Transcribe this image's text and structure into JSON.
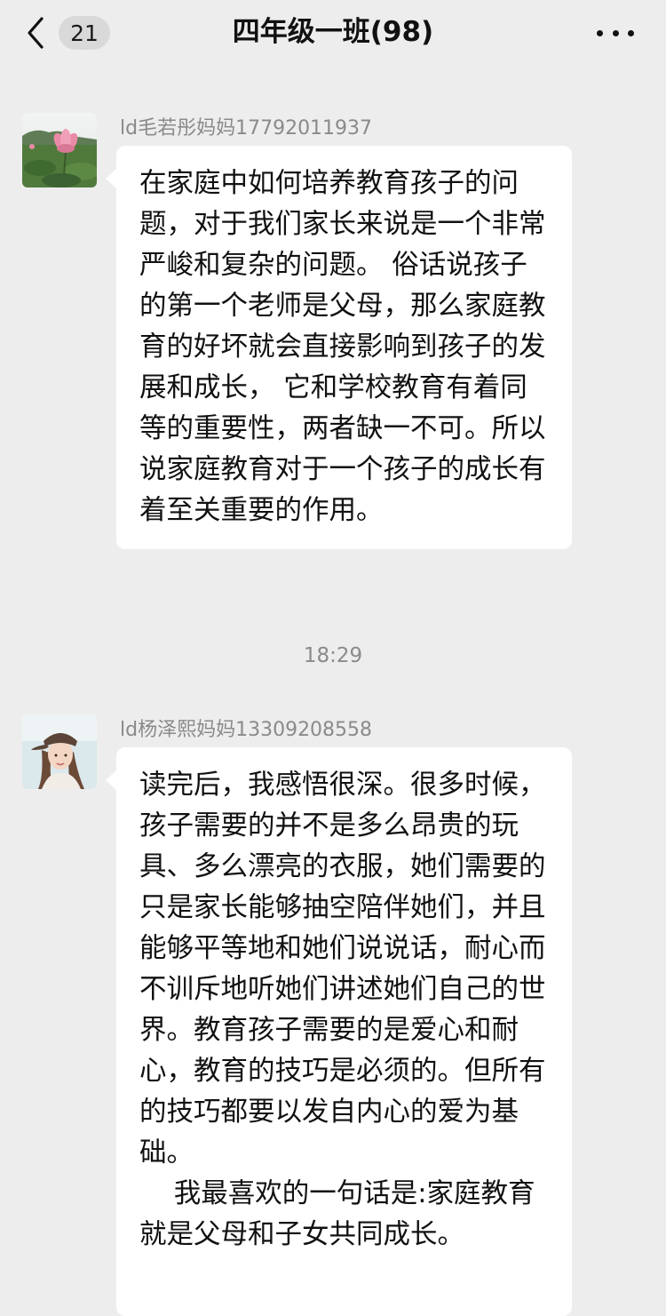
{
  "header": {
    "title": "四年级一班(98)",
    "unread_count": "21",
    "back_icon": "chevron-left-icon",
    "more_icon": "more-dots-icon"
  },
  "messages": [
    {
      "sender": "ld毛若彤妈妈17792011937",
      "avatar": "lotus-flower-avatar",
      "text": "在家庭中如何培养教育孩子的问题，对于我们家长来说是一个非常严峻和复杂的问题。 俗话说孩子的第一个老师是父母，那么家庭教育的好坏就会直接影响到孩子的发展和成长， 它和学校教育有着同等的重要性，两者缺一不可。所以说家庭教育对于一个孩子的成长有着至关重要的作用。"
    },
    {
      "sender": "ld杨泽熙妈妈13309208558",
      "avatar": "woman-with-cap-avatar",
      "text": "读完后，我感悟很深。很多时候，孩子需要的并不是多么昂贵的玩具、多么漂亮的衣服，她们需要的只是家长能够抽空陪伴她们，并且能够平等地和她们说说话，耐心而不训斥地听她们讲述她们自己的世界。教育孩子需要的是爱心和耐心，教育的技巧是必须的。但所有的技巧都要以发自内心的爱为基础。\n    我最喜欢的一句话是:家庭教育就是父母和子女共同成长。"
    }
  ],
  "timestamp": "18:29",
  "colors": {
    "background": "#ededed",
    "bubble": "#ffffff",
    "sender_name": "#8a8a8a",
    "badge": "#d9d9d9"
  }
}
